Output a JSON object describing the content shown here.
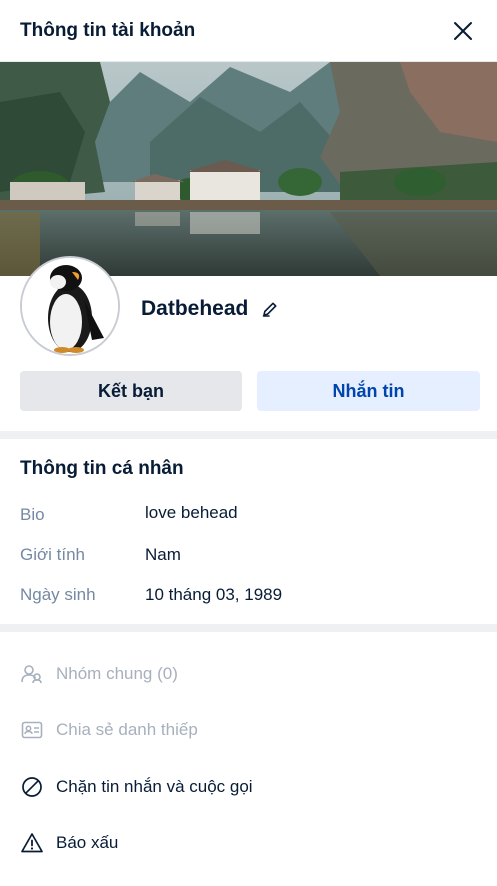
{
  "header": {
    "title": "Thông tin tài khoản",
    "close_icon": "close-icon"
  },
  "profile": {
    "display_name": "Datbehead",
    "edit_icon": "pencil-icon"
  },
  "buttons": {
    "add_friend": "Kết bạn",
    "message": "Nhắn tin"
  },
  "personal_info": {
    "title": "Thông tin cá nhân",
    "rows": [
      {
        "label": "Bio",
        "value": "love behead"
      },
      {
        "label": "Giới tính",
        "value": "Nam"
      },
      {
        "label": "Ngày sinh",
        "value": "10 tháng 03, 1989"
      }
    ]
  },
  "actions": [
    {
      "label": "Nhóm chung (0)",
      "icon": "users-icon",
      "enabled": false
    },
    {
      "label": "Chia sẻ danh thiếp",
      "icon": "contact-card-icon",
      "enabled": false
    },
    {
      "label": "Chặn tin nhắn và cuộc gọi",
      "icon": "block-icon",
      "enabled": true
    },
    {
      "label": "Báo xấu",
      "icon": "warning-icon",
      "enabled": true
    }
  ],
  "colors": {
    "accent": "#0045ad",
    "message_bg": "#e5efff",
    "friend_bg": "#e5e7eb",
    "muted": "#7589a3",
    "disabled": "#a7b0bd"
  }
}
